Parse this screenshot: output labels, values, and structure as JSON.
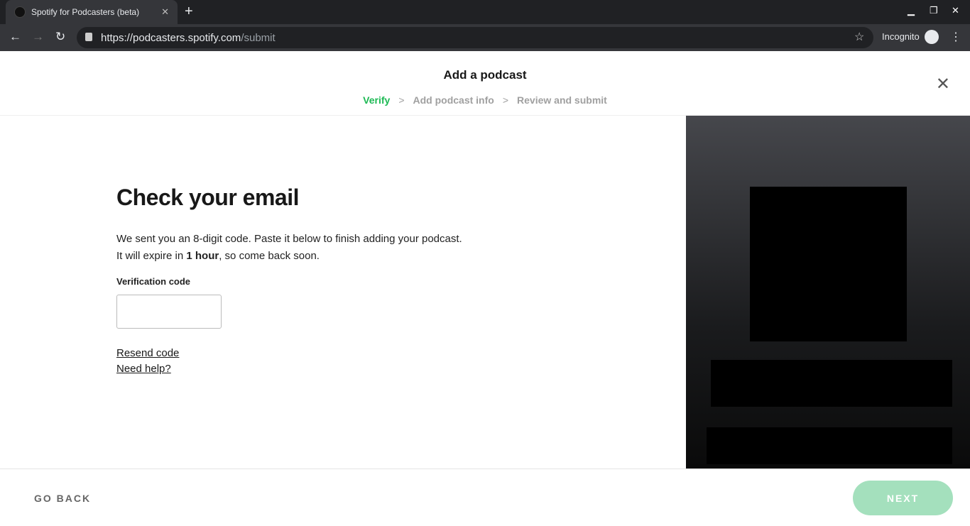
{
  "browser": {
    "tab_title": "Spotify for Podcasters (beta)",
    "url_host": "https://podcasters.spotify.com",
    "url_path": "/submit",
    "incognito_label": "Incognito"
  },
  "header": {
    "title": "Add a podcast",
    "steps": [
      "Verify",
      "Add podcast info",
      "Review and submit"
    ],
    "active_step": 0,
    "accent": "#1db954"
  },
  "main": {
    "heading": "Check your email",
    "line1": "We sent you an 8-digit code. Paste it below to finish adding your podcast.",
    "line2_pre": "It will expire in ",
    "line2_bold": "1 hour",
    "line2_post": ", so come back soon.",
    "field_label": "Verification code",
    "field_value": "",
    "resend": "Resend code",
    "help": "Need help?"
  },
  "footer": {
    "back": "GO BACK",
    "next": "NEXT"
  }
}
